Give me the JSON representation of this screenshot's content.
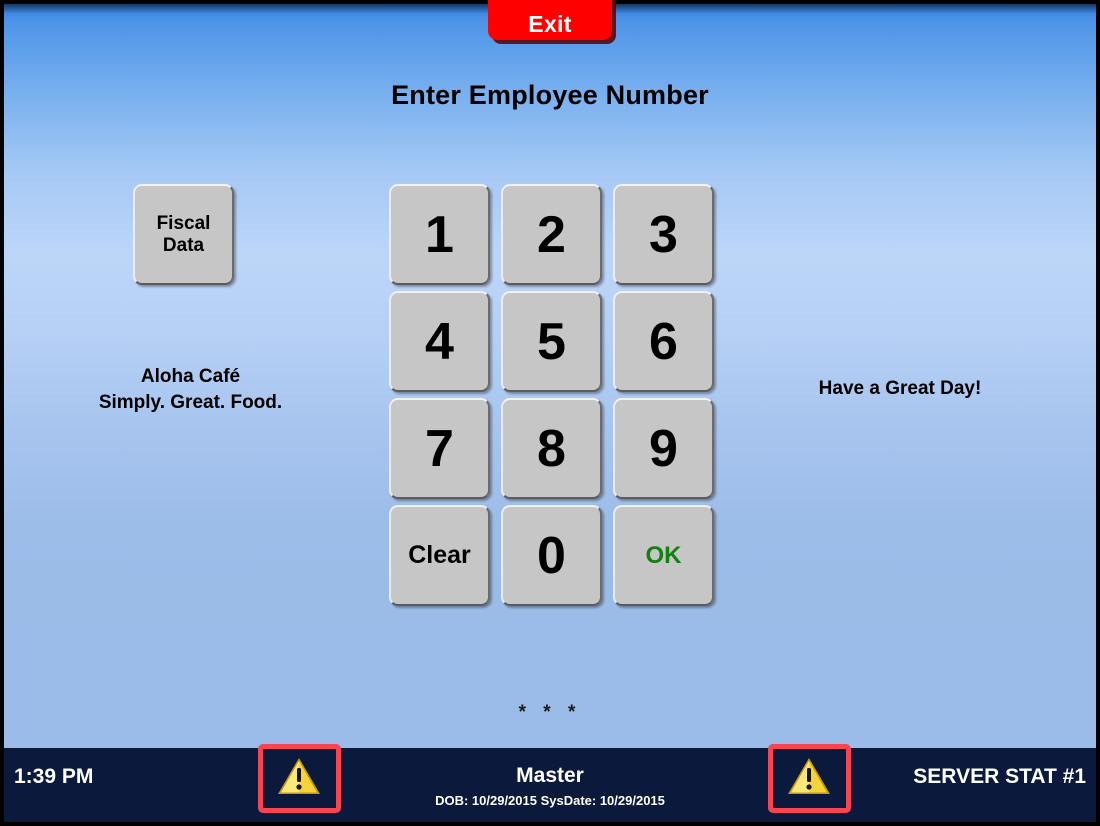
{
  "window": {
    "title": "Aloha POS - Employee Login",
    "background_top_color": "#2f7fe0",
    "background_bottom_color": "#9bbbe8"
  },
  "header": {
    "exit_label": "Exit",
    "exit_color": "#fe0000",
    "title": "Enter Employee Number"
  },
  "left_panel": {
    "fiscal_button_line1": "Fiscal",
    "fiscal_button_line2": "Data",
    "store_name": "Aloha Café",
    "store_slogan": "Simply. Great. Food."
  },
  "right_panel": {
    "greeting": "Have a Great Day!"
  },
  "keypad": {
    "keys": [
      {
        "label": "1",
        "type": "digit"
      },
      {
        "label": "2",
        "type": "digit"
      },
      {
        "label": "3",
        "type": "digit"
      },
      {
        "label": "4",
        "type": "digit"
      },
      {
        "label": "5",
        "type": "digit"
      },
      {
        "label": "6",
        "type": "digit"
      },
      {
        "label": "7",
        "type": "digit"
      },
      {
        "label": "8",
        "type": "digit"
      },
      {
        "label": "9",
        "type": "digit"
      },
      {
        "label": "Clear",
        "type": "action"
      },
      {
        "label": "0",
        "type": "digit"
      },
      {
        "label": "OK",
        "type": "confirm"
      }
    ],
    "ok_color": "#128012"
  },
  "entry": {
    "masked_value": "* * *",
    "digits_entered": 3
  },
  "status_bar": {
    "background_color": "#0b1a3c",
    "time": "1:39 PM",
    "role": "Master",
    "dates": "DOB: 10/29/2015  SysDate: 10/29/2015",
    "terminal": "SERVER STAT #1",
    "warning_left_icon": "warning-triangle-icon",
    "warning_right_icon": "warning-triangle-icon"
  },
  "annotations": {
    "color": "#fa4452",
    "boxes": [
      {
        "target": "warning-icon-left"
      },
      {
        "target": "warning-icon-right"
      }
    ]
  }
}
